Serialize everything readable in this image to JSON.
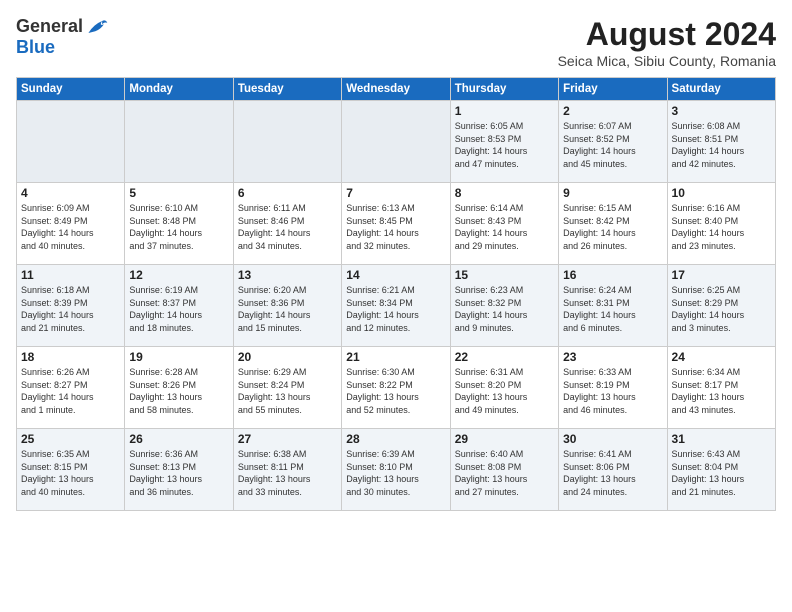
{
  "header": {
    "logo_general": "General",
    "logo_blue": "Blue",
    "month_year": "August 2024",
    "location": "Seica Mica, Sibiu County, Romania"
  },
  "calendar": {
    "days_of_week": [
      "Sunday",
      "Monday",
      "Tuesday",
      "Wednesday",
      "Thursday",
      "Friday",
      "Saturday"
    ],
    "weeks": [
      {
        "row_class": "week-row-1",
        "days": [
          {
            "num": "",
            "info": "",
            "empty": true
          },
          {
            "num": "",
            "info": "",
            "empty": true
          },
          {
            "num": "",
            "info": "",
            "empty": true
          },
          {
            "num": "",
            "info": "",
            "empty": true
          },
          {
            "num": "1",
            "info": "Sunrise: 6:05 AM\nSunset: 8:53 PM\nDaylight: 14 hours\nand 47 minutes.",
            "empty": false
          },
          {
            "num": "2",
            "info": "Sunrise: 6:07 AM\nSunset: 8:52 PM\nDaylight: 14 hours\nand 45 minutes.",
            "empty": false
          },
          {
            "num": "3",
            "info": "Sunrise: 6:08 AM\nSunset: 8:51 PM\nDaylight: 14 hours\nand 42 minutes.",
            "empty": false
          }
        ]
      },
      {
        "row_class": "week-row-2",
        "days": [
          {
            "num": "4",
            "info": "Sunrise: 6:09 AM\nSunset: 8:49 PM\nDaylight: 14 hours\nand 40 minutes.",
            "empty": false
          },
          {
            "num": "5",
            "info": "Sunrise: 6:10 AM\nSunset: 8:48 PM\nDaylight: 14 hours\nand 37 minutes.",
            "empty": false
          },
          {
            "num": "6",
            "info": "Sunrise: 6:11 AM\nSunset: 8:46 PM\nDaylight: 14 hours\nand 34 minutes.",
            "empty": false
          },
          {
            "num": "7",
            "info": "Sunrise: 6:13 AM\nSunset: 8:45 PM\nDaylight: 14 hours\nand 32 minutes.",
            "empty": false
          },
          {
            "num": "8",
            "info": "Sunrise: 6:14 AM\nSunset: 8:43 PM\nDaylight: 14 hours\nand 29 minutes.",
            "empty": false
          },
          {
            "num": "9",
            "info": "Sunrise: 6:15 AM\nSunset: 8:42 PM\nDaylight: 14 hours\nand 26 minutes.",
            "empty": false
          },
          {
            "num": "10",
            "info": "Sunrise: 6:16 AM\nSunset: 8:40 PM\nDaylight: 14 hours\nand 23 minutes.",
            "empty": false
          }
        ]
      },
      {
        "row_class": "week-row-3",
        "days": [
          {
            "num": "11",
            "info": "Sunrise: 6:18 AM\nSunset: 8:39 PM\nDaylight: 14 hours\nand 21 minutes.",
            "empty": false
          },
          {
            "num": "12",
            "info": "Sunrise: 6:19 AM\nSunset: 8:37 PM\nDaylight: 14 hours\nand 18 minutes.",
            "empty": false
          },
          {
            "num": "13",
            "info": "Sunrise: 6:20 AM\nSunset: 8:36 PM\nDaylight: 14 hours\nand 15 minutes.",
            "empty": false
          },
          {
            "num": "14",
            "info": "Sunrise: 6:21 AM\nSunset: 8:34 PM\nDaylight: 14 hours\nand 12 minutes.",
            "empty": false
          },
          {
            "num": "15",
            "info": "Sunrise: 6:23 AM\nSunset: 8:32 PM\nDaylight: 14 hours\nand 9 minutes.",
            "empty": false
          },
          {
            "num": "16",
            "info": "Sunrise: 6:24 AM\nSunset: 8:31 PM\nDaylight: 14 hours\nand 6 minutes.",
            "empty": false
          },
          {
            "num": "17",
            "info": "Sunrise: 6:25 AM\nSunset: 8:29 PM\nDaylight: 14 hours\nand 3 minutes.",
            "empty": false
          }
        ]
      },
      {
        "row_class": "week-row-4",
        "days": [
          {
            "num": "18",
            "info": "Sunrise: 6:26 AM\nSunset: 8:27 PM\nDaylight: 14 hours\nand 1 minute.",
            "empty": false
          },
          {
            "num": "19",
            "info": "Sunrise: 6:28 AM\nSunset: 8:26 PM\nDaylight: 13 hours\nand 58 minutes.",
            "empty": false
          },
          {
            "num": "20",
            "info": "Sunrise: 6:29 AM\nSunset: 8:24 PM\nDaylight: 13 hours\nand 55 minutes.",
            "empty": false
          },
          {
            "num": "21",
            "info": "Sunrise: 6:30 AM\nSunset: 8:22 PM\nDaylight: 13 hours\nand 52 minutes.",
            "empty": false
          },
          {
            "num": "22",
            "info": "Sunrise: 6:31 AM\nSunset: 8:20 PM\nDaylight: 13 hours\nand 49 minutes.",
            "empty": false
          },
          {
            "num": "23",
            "info": "Sunrise: 6:33 AM\nSunset: 8:19 PM\nDaylight: 13 hours\nand 46 minutes.",
            "empty": false
          },
          {
            "num": "24",
            "info": "Sunrise: 6:34 AM\nSunset: 8:17 PM\nDaylight: 13 hours\nand 43 minutes.",
            "empty": false
          }
        ]
      },
      {
        "row_class": "week-row-5",
        "days": [
          {
            "num": "25",
            "info": "Sunrise: 6:35 AM\nSunset: 8:15 PM\nDaylight: 13 hours\nand 40 minutes.",
            "empty": false
          },
          {
            "num": "26",
            "info": "Sunrise: 6:36 AM\nSunset: 8:13 PM\nDaylight: 13 hours\nand 36 minutes.",
            "empty": false
          },
          {
            "num": "27",
            "info": "Sunrise: 6:38 AM\nSunset: 8:11 PM\nDaylight: 13 hours\nand 33 minutes.",
            "empty": false
          },
          {
            "num": "28",
            "info": "Sunrise: 6:39 AM\nSunset: 8:10 PM\nDaylight: 13 hours\nand 30 minutes.",
            "empty": false
          },
          {
            "num": "29",
            "info": "Sunrise: 6:40 AM\nSunset: 8:08 PM\nDaylight: 13 hours\nand 27 minutes.",
            "empty": false
          },
          {
            "num": "30",
            "info": "Sunrise: 6:41 AM\nSunset: 8:06 PM\nDaylight: 13 hours\nand 24 minutes.",
            "empty": false
          },
          {
            "num": "31",
            "info": "Sunrise: 6:43 AM\nSunset: 8:04 PM\nDaylight: 13 hours\nand 21 minutes.",
            "empty": false
          }
        ]
      }
    ]
  }
}
